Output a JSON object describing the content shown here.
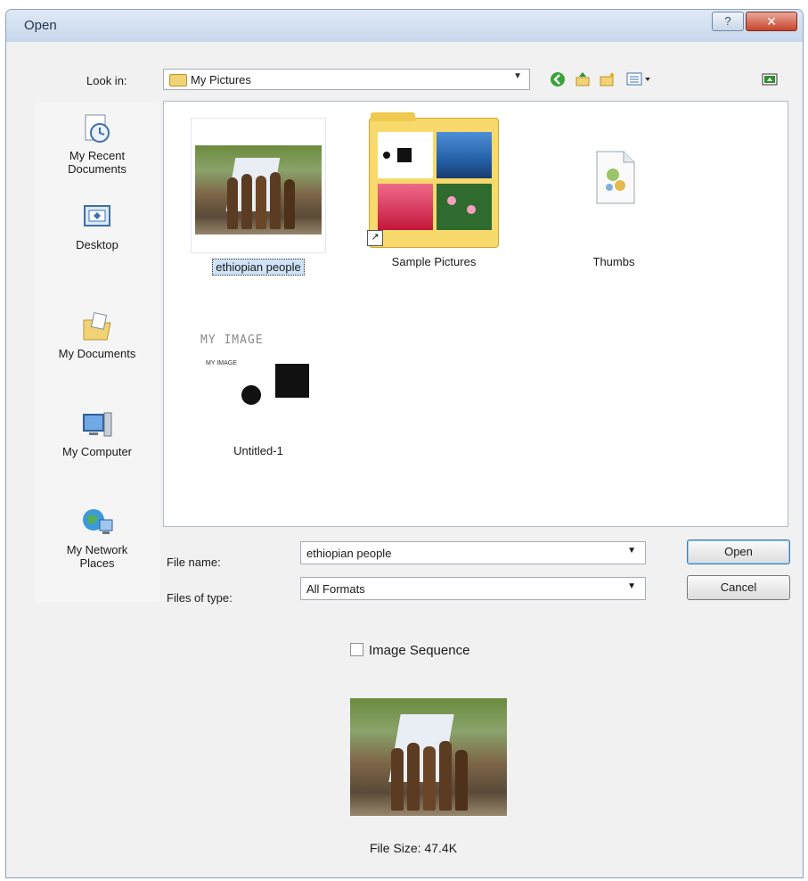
{
  "window": {
    "title": "Open",
    "help_label": "?",
    "close_label": "✕"
  },
  "toolbar": {
    "look_in_label": "Look in:",
    "look_in_value": "My Pictures",
    "icons": [
      "back-icon",
      "up-folder-icon",
      "new-folder-icon",
      "view-menu-icon",
      "preview-toggle-icon"
    ]
  },
  "places": [
    {
      "label": "My Recent Documents",
      "icon": "recent-documents-icon"
    },
    {
      "label": "Desktop",
      "icon": "desktop-icon"
    },
    {
      "label": "My Documents",
      "icon": "my-documents-icon"
    },
    {
      "label": "My Computer",
      "icon": "my-computer-icon"
    },
    {
      "label": "My Network Places",
      "icon": "network-places-icon"
    }
  ],
  "files": [
    {
      "name": "ethiopian people",
      "kind": "image",
      "selected": true
    },
    {
      "name": "Sample Pictures",
      "kind": "folder-shortcut",
      "selected": false
    },
    {
      "name": "Thumbs",
      "kind": "system-file",
      "selected": false
    },
    {
      "name": "Untitled-1",
      "kind": "image",
      "selected": false,
      "thumb_text_1": "MY IMAGE",
      "thumb_text_2": "MY IMAGE"
    }
  ],
  "form": {
    "file_name_label": "File name:",
    "file_name_value": "ethiopian people",
    "file_type_label": "Files of type:",
    "file_type_value": "All Formats",
    "open_label": "Open",
    "cancel_label": "Cancel"
  },
  "options": {
    "image_sequence_label": "Image Sequence",
    "image_sequence_checked": false
  },
  "preview": {
    "file_size_label": "File Size: 47.4K"
  },
  "colors": {
    "title_bar": "#c8d8ec",
    "close_button": "#c8442c",
    "selection": "#cfe3f7",
    "folder": "#f7d96c"
  }
}
